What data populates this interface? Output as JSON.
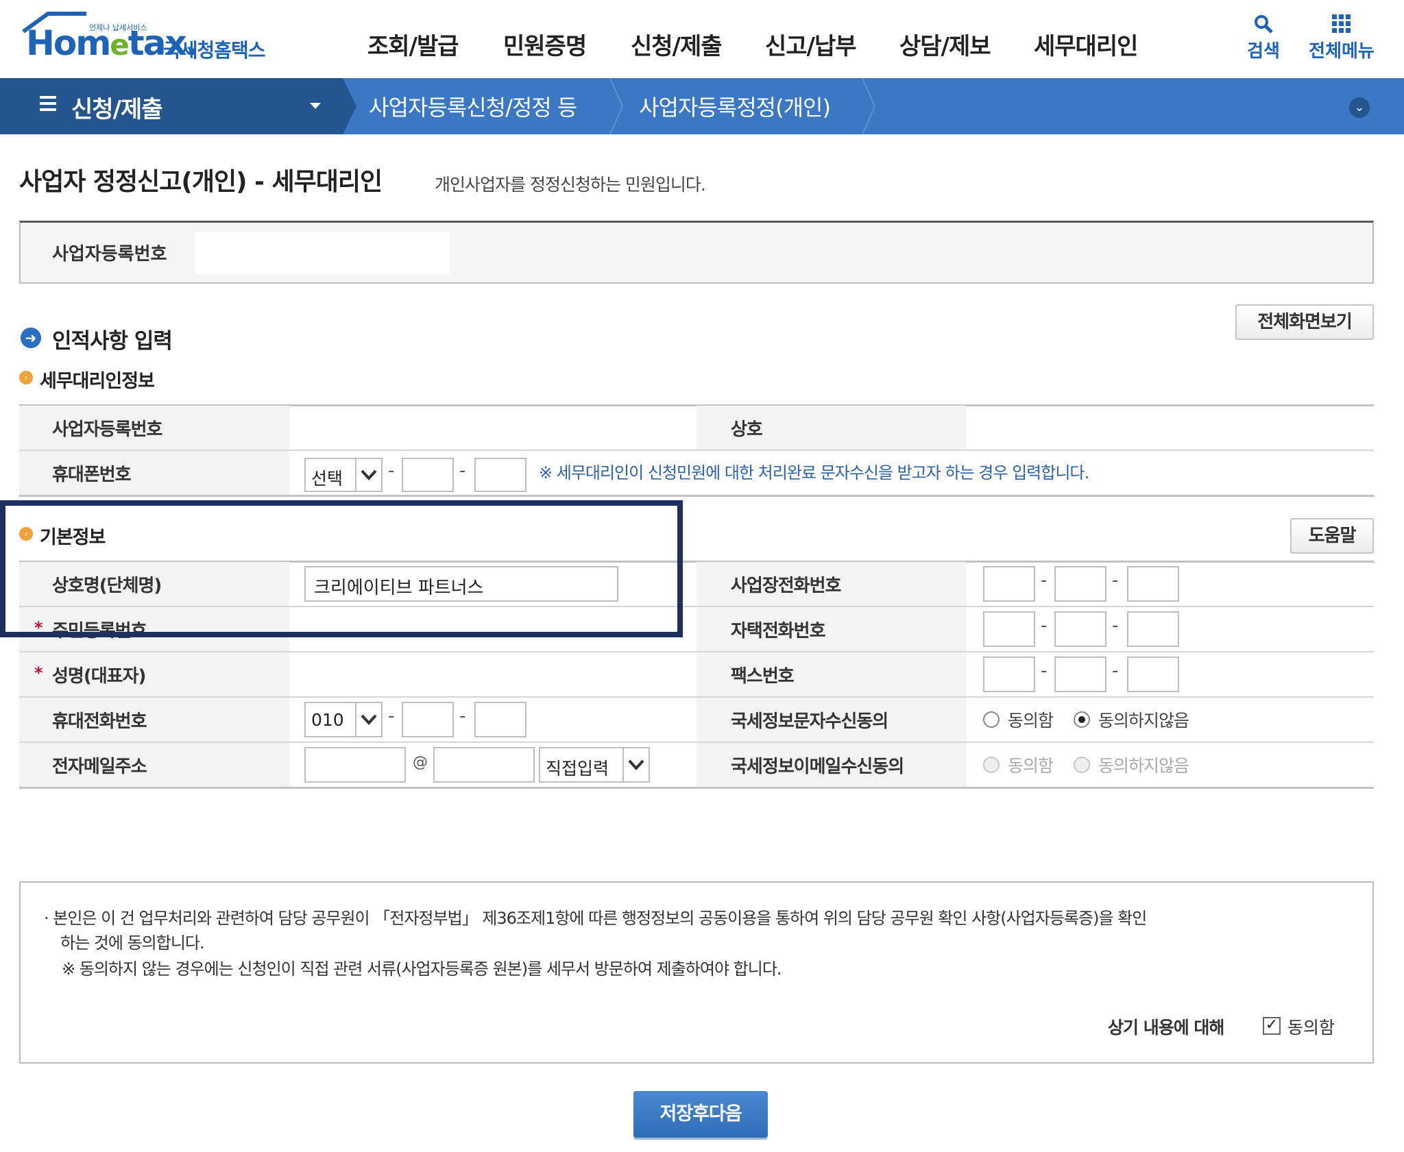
{
  "header": {
    "logo_small": "언제나 납세서비스",
    "logo_main": "Hom",
    "logo_e": "e",
    "logo_tax": "tax.",
    "logo_korean": "국세청홈택스",
    "nav": [
      "조회/발급",
      "민원증명",
      "신청/제출",
      "신고/납부",
      "상담/제보",
      "세무대리인"
    ],
    "search_label": "검색",
    "allmenu_label": "전체메뉴"
  },
  "breadcrumb": {
    "menu": "신청/제출",
    "level2": "사업자등록신청/정정 등",
    "level3": "사업자등록정정(개인)"
  },
  "page": {
    "title": "사업자 정정신고(개인) - 세무대리인",
    "subtitle": "개인사업자를 정정신청하는 민원입니다."
  },
  "biz_box": {
    "label": "사업자등록번호",
    "value": ""
  },
  "section": {
    "title": "인적사항 입력",
    "fullscreen_button": "전체화면보기"
  },
  "agent": {
    "title": "세무대리인정보",
    "biz_no_label": "사업자등록번호",
    "biz_no_value": "",
    "company_label": "상호",
    "company_value": "",
    "mobile_label": "휴대폰번호",
    "mobile_select": "선택",
    "mobile_mid": "",
    "mobile_last": "",
    "note": "※ 세무대리인이 신청민원에 대한 처리완료 문자수신을 받고자 하는 경우 입력합니다."
  },
  "basic": {
    "title": "기본정보",
    "help_button": "도움말",
    "company_name_label": "상호명(단체명)",
    "company_name_value": "크리에이티브 파트너스",
    "resident_no_label": "주민등록번호",
    "name_label": "성명(대표자)",
    "mobile_label": "휴대전화번호",
    "mobile_select": "010",
    "email_label": "전자메일주소",
    "email_at": "@",
    "email_domain_select": "직접입력",
    "biz_phone_label": "사업장전화번호",
    "home_phone_label": "자택전화번호",
    "fax_label": "팩스번호",
    "sms_consent_label": "국세정보문자수신동의",
    "email_consent_label": "국세정보이메일수신동의",
    "agree": "동의함",
    "disagree": "동의하지않음",
    "sms_consent": "동의하지않음",
    "email_consent": "",
    "required_mark": "*",
    "dash": "-"
  },
  "agreement": {
    "line1": "· 본인은 이 건 업무처리와 관련하여 담당 공무원이 「전자정부법」 제36조제1항에 따른 행정정보의 공동이용을 통하여 위의 담당 공무원 확인 사항(사업자등록증)을 확인",
    "line2": "하는 것에 동의합니다.",
    "line3": "※ 동의하지 않는 경우에는 신청인이 직접 관련 서류(사업자등록증 원본)를 세무서 방문하여 제출하여야 합니다.",
    "question": "상기 내용에 대해",
    "check_label": "동의함",
    "checked": "✓"
  },
  "save_button": "저장후다음",
  "colors": {
    "brand_blue": "#1e63b5",
    "bar_blue": "#3c77c3",
    "bar_dark": "#24558f",
    "highlight": "#1c2f5e",
    "note_blue": "#2d62a8"
  }
}
